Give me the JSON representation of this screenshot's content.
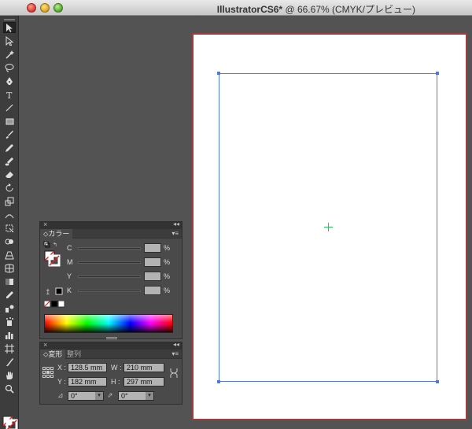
{
  "window": {
    "title_bold": "IllustratorCS6*",
    "title_tail": " @ 66.67% (CMYK/プレビュー)"
  },
  "tools": [
    "selection-tool",
    "direct-selection-tool",
    "magic-wand-tool",
    "lasso-tool",
    "pen-tool",
    "type-tool",
    "line-tool",
    "rectangle-tool",
    "paintbrush-tool",
    "pencil-tool",
    "blob-brush-tool",
    "eraser-tool",
    "rotate-tool",
    "scale-tool",
    "width-tool",
    "free-transform-tool",
    "shape-builder-tool",
    "perspective-grid-tool",
    "mesh-tool",
    "gradient-tool",
    "eyedropper-tool",
    "blend-tool",
    "symbol-sprayer-tool",
    "column-graph-tool",
    "artboard-tool",
    "slice-tool",
    "hand-tool",
    "zoom-tool"
  ],
  "color_panel": {
    "tab": "カラー",
    "rows": [
      {
        "label": "C",
        "unit": "%"
      },
      {
        "label": "M",
        "unit": "%"
      },
      {
        "label": "Y",
        "unit": "%"
      },
      {
        "label": "K",
        "unit": "%"
      }
    ]
  },
  "transform_panel": {
    "tabs": [
      "変形",
      "整列"
    ],
    "x_label": "X :",
    "x_value": "128.5 mm",
    "w_label": "W :",
    "w_value": "210 mm",
    "y_label": "Y :",
    "y_value": "182 mm",
    "h_label": "H :",
    "h_value": "297 mm",
    "rotate_value": "0°",
    "shear_value": "0°"
  },
  "colors": {
    "artboard_border": "#a33b3b",
    "guide": "#4f78e6",
    "center_mark": "#22c55e"
  }
}
